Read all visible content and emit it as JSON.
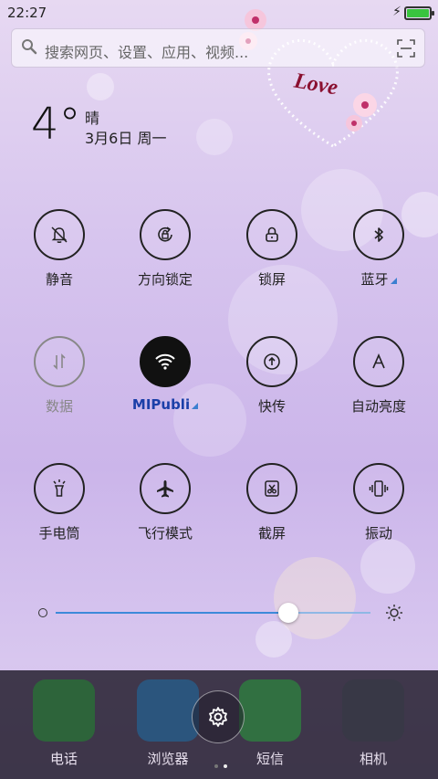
{
  "status_bar": {
    "time": "22:27",
    "battery_level": 1.0
  },
  "search": {
    "placeholder": "搜索网页、设置、应用、视频..."
  },
  "weather": {
    "temperature": "4°",
    "condition": "晴",
    "date": "3月6日 周一"
  },
  "decoration": {
    "heart_text": "Love"
  },
  "toggles": [
    {
      "label": "静音",
      "icon": "bell-off-icon",
      "state": "off"
    },
    {
      "label": "方向锁定",
      "icon": "rotation-lock-icon",
      "state": "off"
    },
    {
      "label": "锁屏",
      "icon": "lock-icon",
      "state": "off"
    },
    {
      "label": "蓝牙",
      "icon": "bluetooth-icon",
      "state": "off",
      "has_submenu": true
    },
    {
      "label": "数据",
      "icon": "mobile-data-icon",
      "state": "disabled"
    },
    {
      "label": "MIPubli",
      "icon": "wifi-icon",
      "state": "on",
      "has_submenu": true
    },
    {
      "label": "快传",
      "icon": "upload-transfer-icon",
      "state": "off"
    },
    {
      "label": "自动亮度",
      "icon": "auto-brightness-icon",
      "state": "off"
    },
    {
      "label": "手电筒",
      "icon": "flashlight-icon",
      "state": "off"
    },
    {
      "label": "飞行模式",
      "icon": "airplane-icon",
      "state": "off"
    },
    {
      "label": "截屏",
      "icon": "screenshot-icon",
      "state": "off"
    },
    {
      "label": "振动",
      "icon": "vibrate-icon",
      "state": "off"
    }
  ],
  "brightness": {
    "level": 0.74
  },
  "dock": {
    "apps": [
      {
        "label": "电话",
        "icon": "phone-icon",
        "color": "#1f8a2e"
      },
      {
        "label": "浏览器",
        "icon": "browser-icon",
        "color": "#1c6fa8"
      },
      {
        "label": "短信",
        "icon": "messages-icon",
        "color": "#27a03a"
      },
      {
        "label": "相机",
        "icon": "camera-icon",
        "color": "#333a44"
      }
    ],
    "settings_icon": "gear-icon",
    "page_count": 2,
    "current_page": 2
  },
  "colors": {
    "accent": "#3c8ad9",
    "wifi_label": "#1b3fa8"
  }
}
